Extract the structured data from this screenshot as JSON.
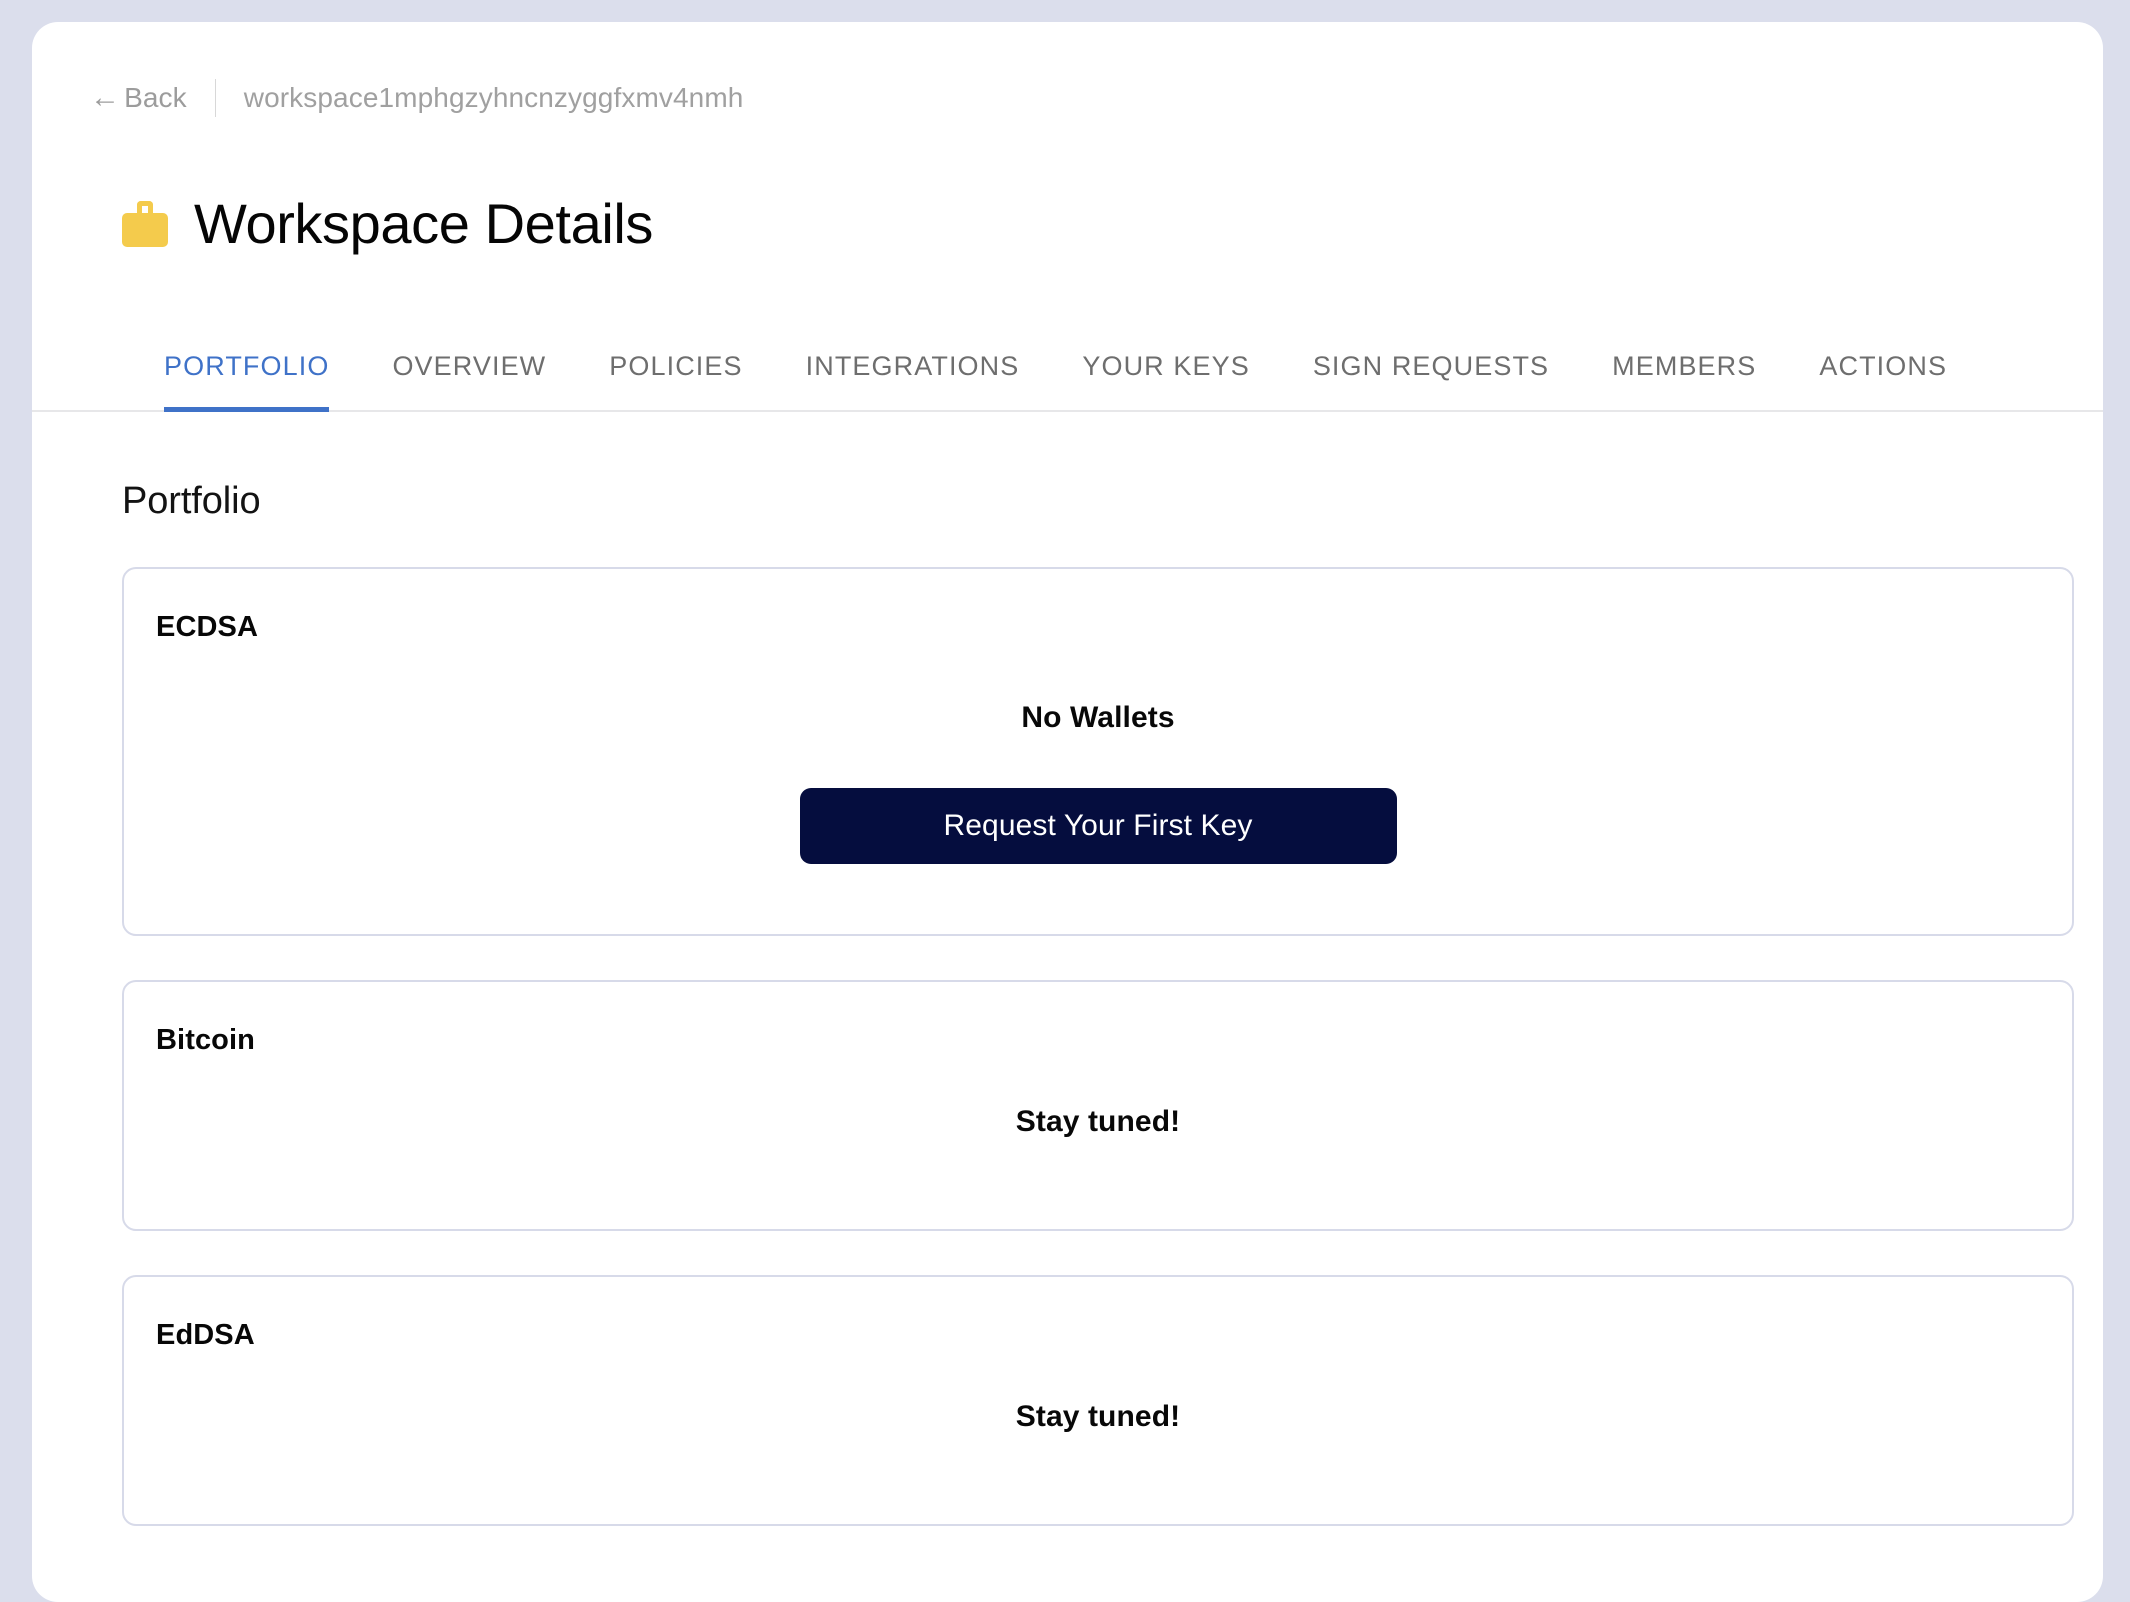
{
  "breadcrumb": {
    "back_label": "Back",
    "back_arrow": "←",
    "workspace_id": "workspace1mphgzyhncnzyggfxmv4nmh"
  },
  "header": {
    "icon": "briefcase-icon",
    "title": "Workspace Details"
  },
  "tabs": [
    {
      "label": "PORTFOLIO",
      "active": true
    },
    {
      "label": "OVERVIEW",
      "active": false
    },
    {
      "label": "POLICIES",
      "active": false
    },
    {
      "label": "INTEGRATIONS",
      "active": false
    },
    {
      "label": "YOUR KEYS",
      "active": false
    },
    {
      "label": "SIGN REQUESTS",
      "active": false
    },
    {
      "label": "MEMBERS",
      "active": false
    },
    {
      "label": "ACTIONS",
      "active": false
    }
  ],
  "main": {
    "section_title": "Portfolio",
    "cards": [
      {
        "title": "ECDSA",
        "empty_heading": "No Wallets",
        "button_label": "Request Your First Key"
      },
      {
        "title": "Bitcoin",
        "message": "Stay tuned!"
      },
      {
        "title": "EdDSA",
        "message": "Stay tuned!"
      }
    ]
  },
  "colors": {
    "page_background": "#dbdeec",
    "panel_background": "#ffffff",
    "accent_blue": "#3f72c8",
    "primary_button": "#050d3e",
    "icon_yellow": "#f4cb4c",
    "card_border": "#d7dae9",
    "muted_text": "#9c9c9c"
  }
}
